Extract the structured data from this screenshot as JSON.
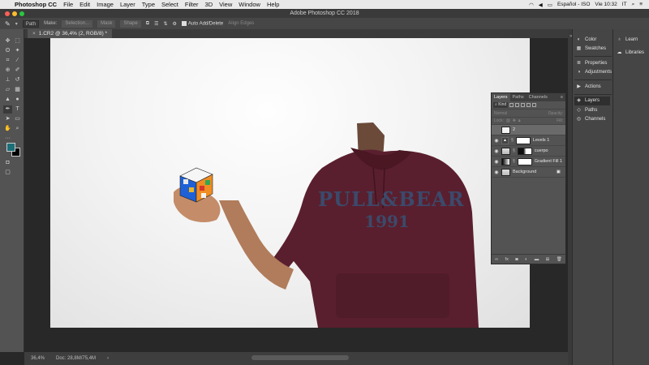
{
  "menubar": {
    "app_name": "Photoshop CC",
    "items": [
      "File",
      "Edit",
      "Image",
      "Layer",
      "Type",
      "Select",
      "Filter",
      "3D",
      "View",
      "Window",
      "Help"
    ],
    "input_lang": "Español - ISO",
    "clock": "Vie 10:32",
    "user": "IT"
  },
  "titlebar": {
    "title": "Adobe Photoshop CC 2018"
  },
  "options": {
    "mode": "Path",
    "make_label": "Make:",
    "selection_btn": "Selection...",
    "mask_btn": "Mask",
    "shape_btn": "Shape",
    "auto_add_delete": "Auto Add/Delete",
    "align_edges": "Align Edges"
  },
  "document": {
    "tab_label": "1.CR2 @ 36,4% (2, RGB/8) *",
    "subject_text_line1": "PULL&BEAR",
    "subject_text_line2": "1991"
  },
  "status": {
    "zoom": "36,4%",
    "doc_info": "Doc: 28,8M/75,4M"
  },
  "panels": {
    "color": "Color",
    "swatches": "Swatches",
    "properties": "Properties",
    "adjustments": "Adjustments",
    "actions": "Actions",
    "layers": "Layers",
    "paths": "Paths",
    "channels": "Channels",
    "learn": "Learn",
    "libraries": "Libraries"
  },
  "layers_panel": {
    "tabs": [
      "Layers",
      "Paths",
      "Channels"
    ],
    "filter_kind": "Kind",
    "blend_mode": "Normal",
    "opacity_label": "Opacity:",
    "lock_label": "Lock:",
    "fill_label": "Fill:",
    "layers": [
      {
        "name": "2",
        "type": "pixel",
        "selected": true
      },
      {
        "name": "Levels 1",
        "type": "adjustment",
        "selected": false
      },
      {
        "name": "cuerpo",
        "type": "photo",
        "selected": false
      },
      {
        "name": "Gradient Fill 1",
        "type": "gradient",
        "selected": false
      },
      {
        "name": "Background",
        "type": "background",
        "selected": false
      }
    ],
    "bottom_icons": [
      "link-icon",
      "fx-icon",
      "mask-icon",
      "adjustment-icon",
      "folder-icon",
      "new-layer-icon",
      "trash-icon"
    ]
  },
  "colors": {
    "foreground": "#1b6f78",
    "background": "#000000",
    "hoodie": "#5a1f2e"
  }
}
